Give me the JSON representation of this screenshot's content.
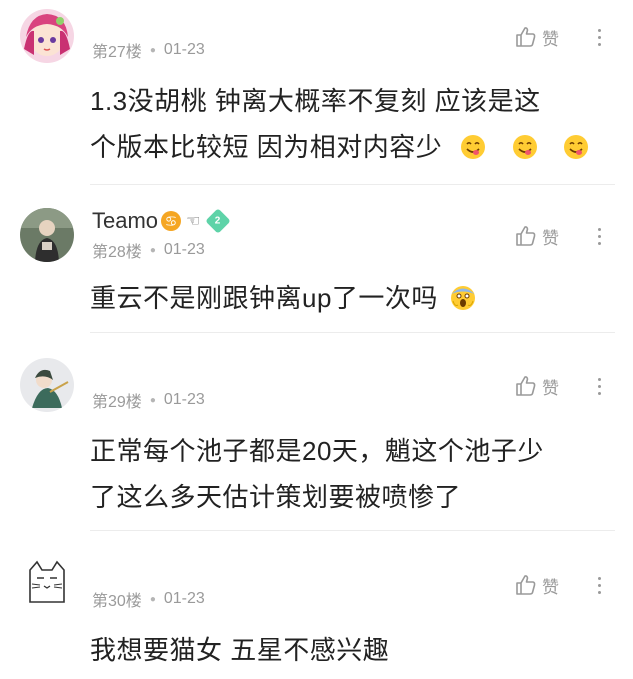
{
  "comments": [
    {
      "floor": "第27楼",
      "date": "01-23",
      "like_label": "赞",
      "content_lines": [
        "1.3没胡桃 钟离大概率不复刻 应该是这",
        "个版本比较短 因为相对内容少"
      ],
      "emoji_icons": [
        "yum-face-icon",
        "yum-face-icon",
        "yum-face-icon"
      ]
    },
    {
      "author": "Teamo",
      "level": "2",
      "floor": "第28楼",
      "date": "01-23",
      "like_label": "赞",
      "content_lines": [
        "重云不是刚跟钟离up了一次吗"
      ],
      "emoji_icons": [
        "scream-face-icon"
      ]
    },
    {
      "floor": "第29楼",
      "date": "01-23",
      "like_label": "赞",
      "content_lines": [
        "正常每个池子都是20天，魈这个池子少",
        "了这么多天估计策划要被喷惨了"
      ]
    },
    {
      "floor": "第30楼",
      "date": "01-23",
      "like_label": "赞",
      "content_lines": [
        "我想要猫女 五星不感兴趣"
      ]
    }
  ],
  "colors": {
    "meta_text": "#9a9a9a",
    "content_text": "#222222",
    "zodiac_badge": "#f5a623",
    "level_badge": "#5ed3a8"
  }
}
